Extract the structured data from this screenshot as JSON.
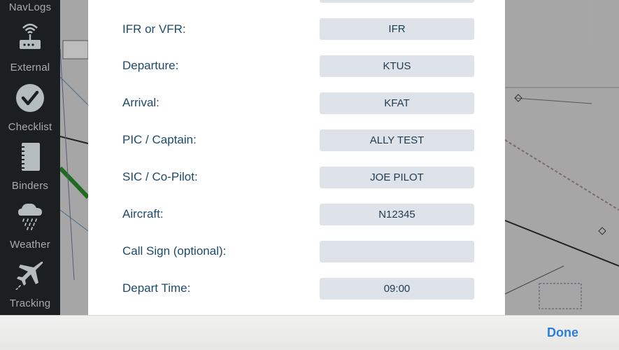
{
  "sidebar": {
    "items": [
      {
        "label": "NavLogs"
      },
      {
        "label": "External",
        "icon": "router-icon"
      },
      {
        "label": "Checklist",
        "icon": "checkmark-circle-icon"
      },
      {
        "label": "Binders",
        "icon": "binder-icon"
      },
      {
        "label": "Weather",
        "icon": "rain-cloud-icon"
      },
      {
        "label": "Tracking",
        "icon": "airplane-icon"
      }
    ]
  },
  "form": {
    "rows": [
      {
        "label": "IFR or VFR:",
        "value": "IFR"
      },
      {
        "label": "Departure:",
        "value": "KTUS"
      },
      {
        "label": "Arrival:",
        "value": "KFAT"
      },
      {
        "label": "PIC / Captain:",
        "value": "ALLY TEST"
      },
      {
        "label": "SIC / Co-Pilot:",
        "value": "JOE PILOT"
      },
      {
        "label": "Aircraft:",
        "value": "N12345"
      },
      {
        "label": "Call Sign (optional):",
        "value": ""
      },
      {
        "label": "Depart Time:",
        "value": "09:00"
      }
    ]
  },
  "toolbar": {
    "done_label": "Done"
  },
  "colors": {
    "accent": "#2b7fd6",
    "label": "#1e4a6a",
    "field_bg": "#dde3e8",
    "sidebar_bg": "#1c1f22"
  }
}
